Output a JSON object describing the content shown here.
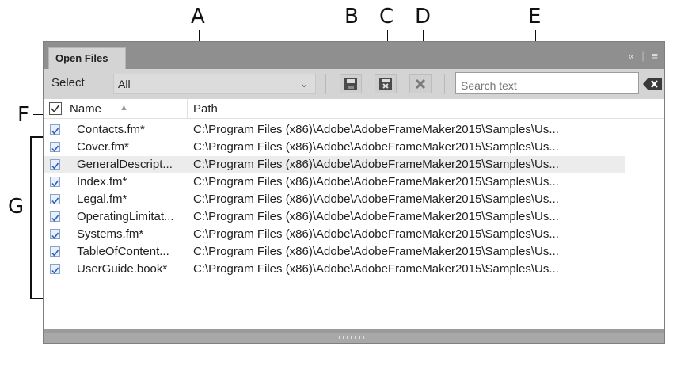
{
  "callouts": {
    "a": "A",
    "b": "B",
    "c": "C",
    "d": "D",
    "e": "E",
    "f": "F",
    "g": "G"
  },
  "panel": {
    "tab_label": "Open Files",
    "select_label": "Select",
    "select_value": "All",
    "search_placeholder": "Search text"
  },
  "list": {
    "header_name": "Name",
    "header_path": "Path",
    "rows": [
      {
        "name": "Contacts.fm*",
        "path": "C:\\Program Files (x86)\\Adobe\\AdobeFrameMaker2015\\Samples\\Us..."
      },
      {
        "name": "Cover.fm*",
        "path": "C:\\Program Files (x86)\\Adobe\\AdobeFrameMaker2015\\Samples\\Us..."
      },
      {
        "name": "GeneralDescript...",
        "path": "C:\\Program Files (x86)\\Adobe\\AdobeFrameMaker2015\\Samples\\Us..."
      },
      {
        "name": "Index.fm*",
        "path": "C:\\Program Files (x86)\\Adobe\\AdobeFrameMaker2015\\Samples\\Us..."
      },
      {
        "name": "Legal.fm*",
        "path": "C:\\Program Files (x86)\\Adobe\\AdobeFrameMaker2015\\Samples\\Us..."
      },
      {
        "name": "OperatingLimitat...",
        "path": "C:\\Program Files (x86)\\Adobe\\AdobeFrameMaker2015\\Samples\\Us..."
      },
      {
        "name": "Systems.fm*",
        "path": "C:\\Program Files (x86)\\Adobe\\AdobeFrameMaker2015\\Samples\\Us..."
      },
      {
        "name": "TableOfContent...",
        "path": "C:\\Program Files (x86)\\Adobe\\AdobeFrameMaker2015\\Samples\\Us..."
      },
      {
        "name": "UserGuide.book*",
        "path": "C:\\Program Files (x86)\\Adobe\\AdobeFrameMaker2015\\Samples\\Us..."
      }
    ]
  },
  "icons": {
    "save": "save-icon",
    "save_all": "save-all-icon",
    "close": "close-icon",
    "clear_search": "clear-search-icon",
    "panel_menu": "panel-menu-icon",
    "collapse": "collapse-icon",
    "sort": "sort-ascending-icon",
    "resize_grip": "resize-grip-icon"
  },
  "colors": {
    "panel_bg": "#d4d4d4",
    "tab_strip": "#8f8f8f",
    "checkbox": "#3b6fc4",
    "row_highlight": "#ececec"
  }
}
